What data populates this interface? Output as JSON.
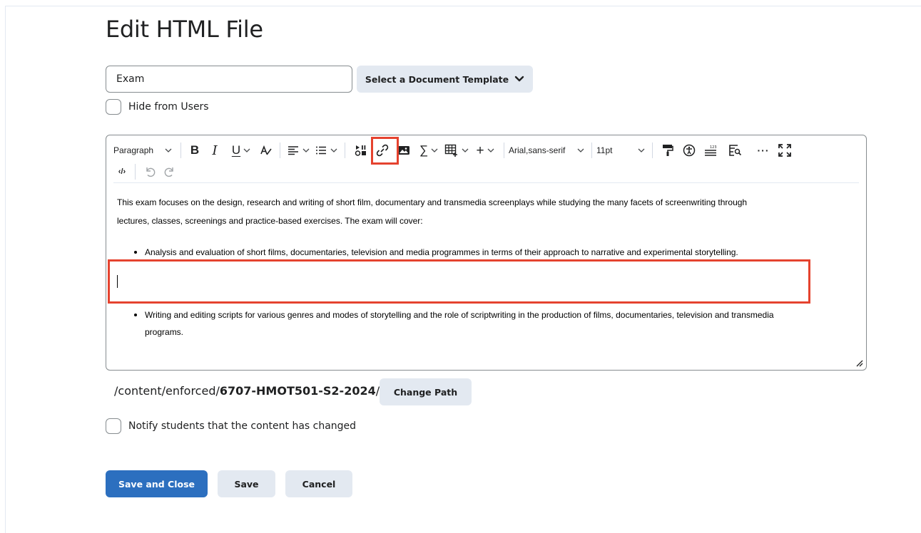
{
  "page": {
    "title": "Edit HTML File"
  },
  "form": {
    "title_value": "Exam",
    "template_button": "Select a Document Template",
    "hide_label": "Hide from Users",
    "notify_label": "Notify students that the content has changed"
  },
  "toolbar": {
    "block_format": "Paragraph",
    "font_family": "Arial,sans-serif",
    "font_size": "11pt",
    "bold_glyph": "B",
    "italic_glyph": "I",
    "underline_glyph": "U",
    "sigma_glyph": "∑",
    "plus_glyph": "+",
    "more_glyph": "···",
    "code_glyph": "‹/›"
  },
  "content": {
    "intro_line1": "This exam focuses on the design, research and writing of short film, documentary and transmedia screenplays while studying the many facets of screenwriting through",
    "intro_line2": "lectures, classes, screenings and practice-based exercises. The exam will cover:",
    "bullet1": "Analysis and evaluation of short films, documentaries, television and media programmes in terms of their approach to narrative and experimental storytelling.",
    "bullet2_line1": "Writing and editing scripts for various genres and modes of storytelling and the role of scriptwriting in the production of films, documentaries, television and transmedia",
    "bullet2_line2": "programs."
  },
  "path": {
    "prefix": "/content/enforced/",
    "course": "6707-HMOT501-S2-2024",
    "suffix": "/",
    "change_button": "Change Path"
  },
  "actions": {
    "save_close": "Save and Close",
    "save": "Save",
    "cancel": "Cancel"
  },
  "colors": {
    "primary": "#2c6fbf",
    "secondary_button": "#e3e9f1",
    "highlight": "#e5432f",
    "border": "#868c8f"
  }
}
